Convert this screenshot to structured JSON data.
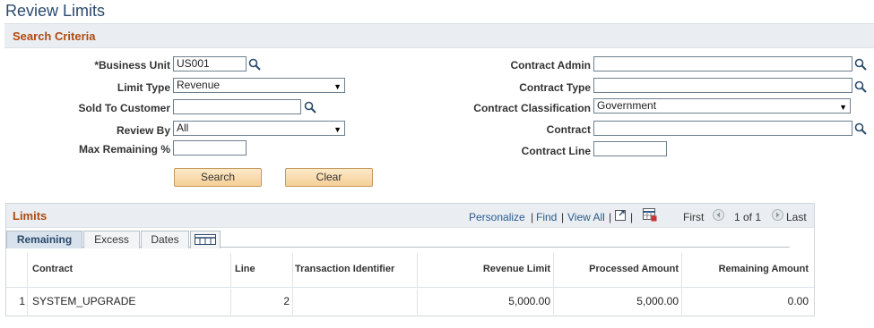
{
  "page": {
    "title": "Review Limits"
  },
  "search_criteria": {
    "title": "Search Criteria",
    "business_unit": {
      "label": "*Business Unit",
      "value": "US001"
    },
    "limit_type": {
      "label": "Limit Type",
      "value": "Revenue"
    },
    "sold_to_customer": {
      "label": "Sold To Customer",
      "value": ""
    },
    "review_by": {
      "label": "Review By",
      "value": "All"
    },
    "max_remaining": {
      "label": "Max Remaining %",
      "value": ""
    },
    "contract_admin": {
      "label": "Contract Admin",
      "value": ""
    },
    "contract_type": {
      "label": "Contract Type",
      "value": ""
    },
    "contract_classification": {
      "label": "Contract Classification",
      "value": "Government"
    },
    "contract": {
      "label": "Contract",
      "value": ""
    },
    "contract_line": {
      "label": "Contract Line",
      "value": ""
    },
    "search_label": "Search",
    "clear_label": "Clear"
  },
  "limits": {
    "title": "Limits",
    "toolbar": {
      "personalize": "Personalize",
      "find": "Find",
      "view_all": "View All",
      "first": "First",
      "range": "1 of 1",
      "last": "Last",
      "sep": "|"
    },
    "tabs": [
      "Remaining",
      "Excess",
      "Dates"
    ],
    "columns": [
      "Contract",
      "Line",
      "Transaction Identifier",
      "Revenue Limit",
      "Processed Amount",
      "Remaining Amount"
    ],
    "rows": [
      {
        "num": "1",
        "contract": "SYSTEM_UPGRADE",
        "line": "2",
        "transaction_identifier": "",
        "revenue_limit": "5,000.00",
        "processed_amount": "5,000.00",
        "remaining_amount": "0.00"
      }
    ]
  },
  "icons": {
    "lookup": "magnifier-icon",
    "dropdown": "chevron-down-icon",
    "new_window": "new-window-icon",
    "download": "grid-download-icon",
    "prev": "prev-arrow-icon",
    "next": "next-arrow-icon",
    "show_all_columns": "show-all-columns-icon"
  }
}
